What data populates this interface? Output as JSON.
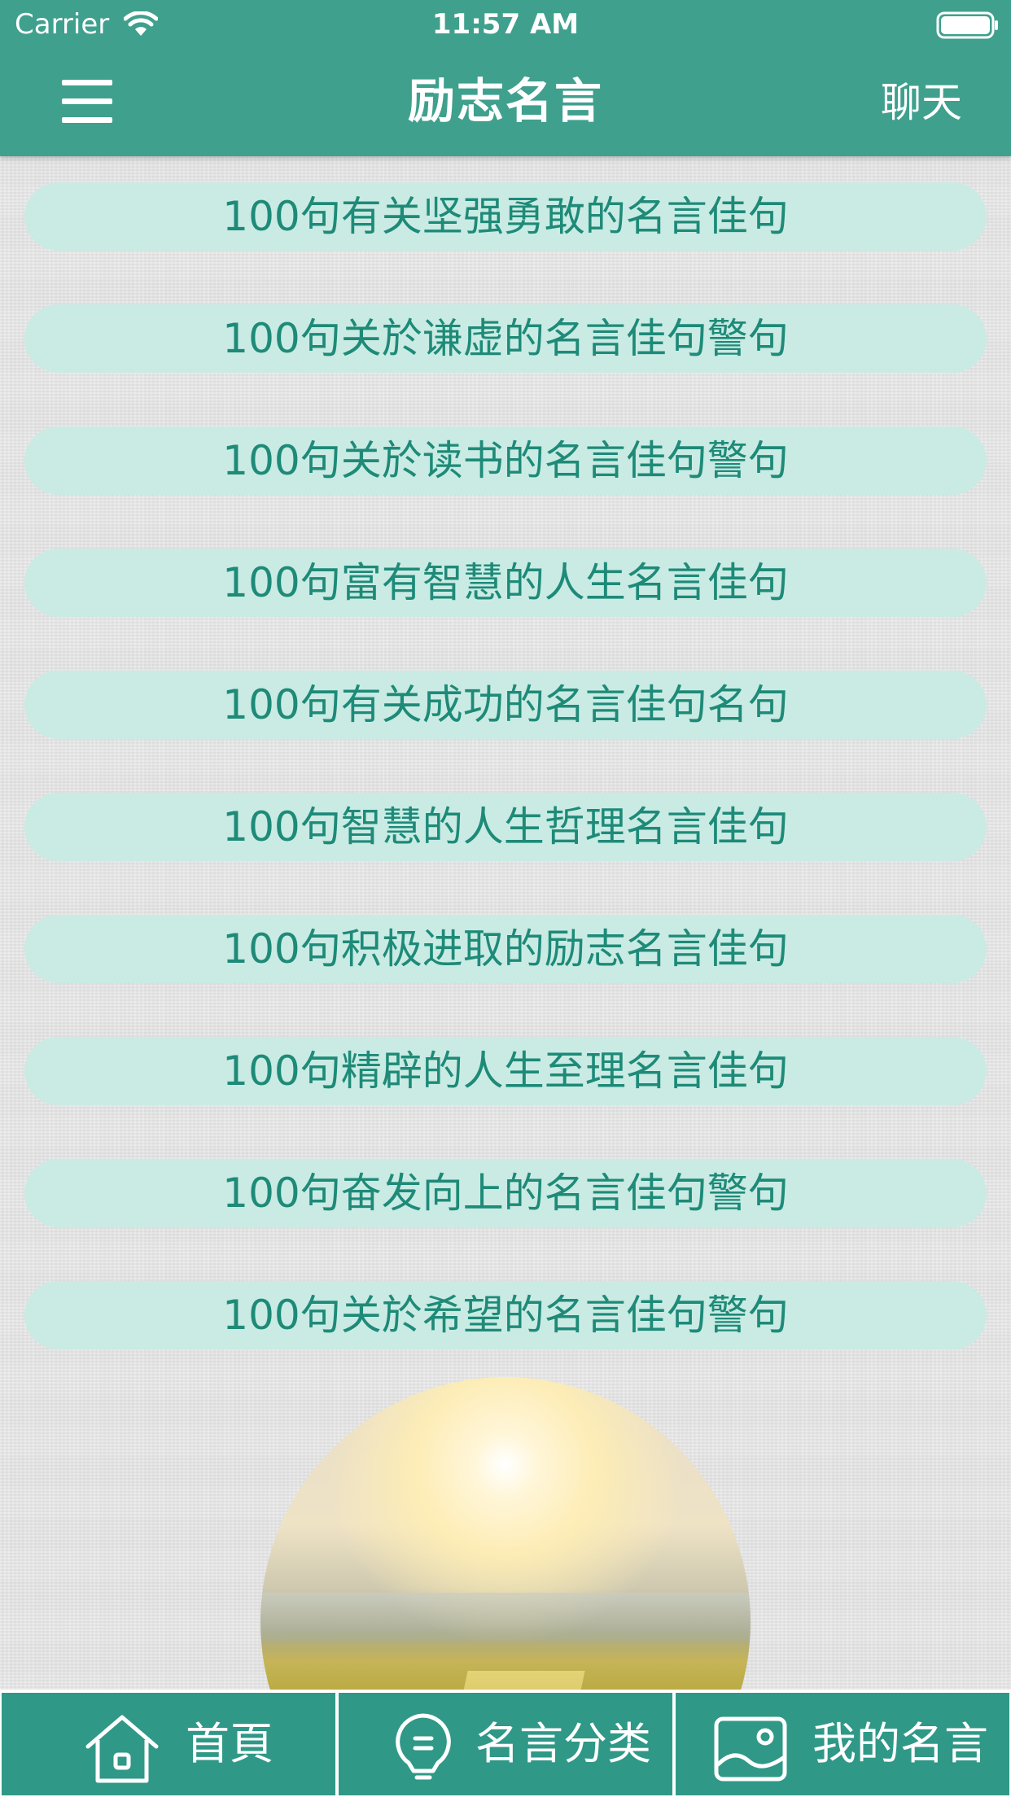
{
  "status_bar": {
    "carrier": "Carrier",
    "time": "11:57 AM",
    "icons": [
      "wifi-icon",
      "battery-icon"
    ]
  },
  "header": {
    "title": "励志名言",
    "right_link": "聊天",
    "menu_icon": "hamburger-menu-icon",
    "background_color": "#3fa08d"
  },
  "quotes": [
    "100句有关坚强勇敢的名言佳句",
    "100句关於谦虚的名言佳句警句",
    "100句关於读书的名言佳句警句",
    "100句富有智慧的人生名言佳句",
    "100句有关成功的名言佳句名句",
    "100句智慧的人生哲理名言佳句",
    "100句积极进取的励志名言佳句",
    "100句精辟的人生至理名言佳句",
    "100句奋发向上的名言佳句警句",
    "100句关於希望的名言佳句警句"
  ],
  "list_style": {
    "pill_color": "#c9ebe4",
    "text_color": "#1e8a78"
  },
  "tabs": [
    {
      "label": "首頁",
      "icon": "home-icon"
    },
    {
      "label": "名言分类",
      "icon": "lightbulb-icon"
    },
    {
      "label": "我的名言",
      "icon": "picture-icon"
    }
  ],
  "tab_bar_color": "#2f9887"
}
